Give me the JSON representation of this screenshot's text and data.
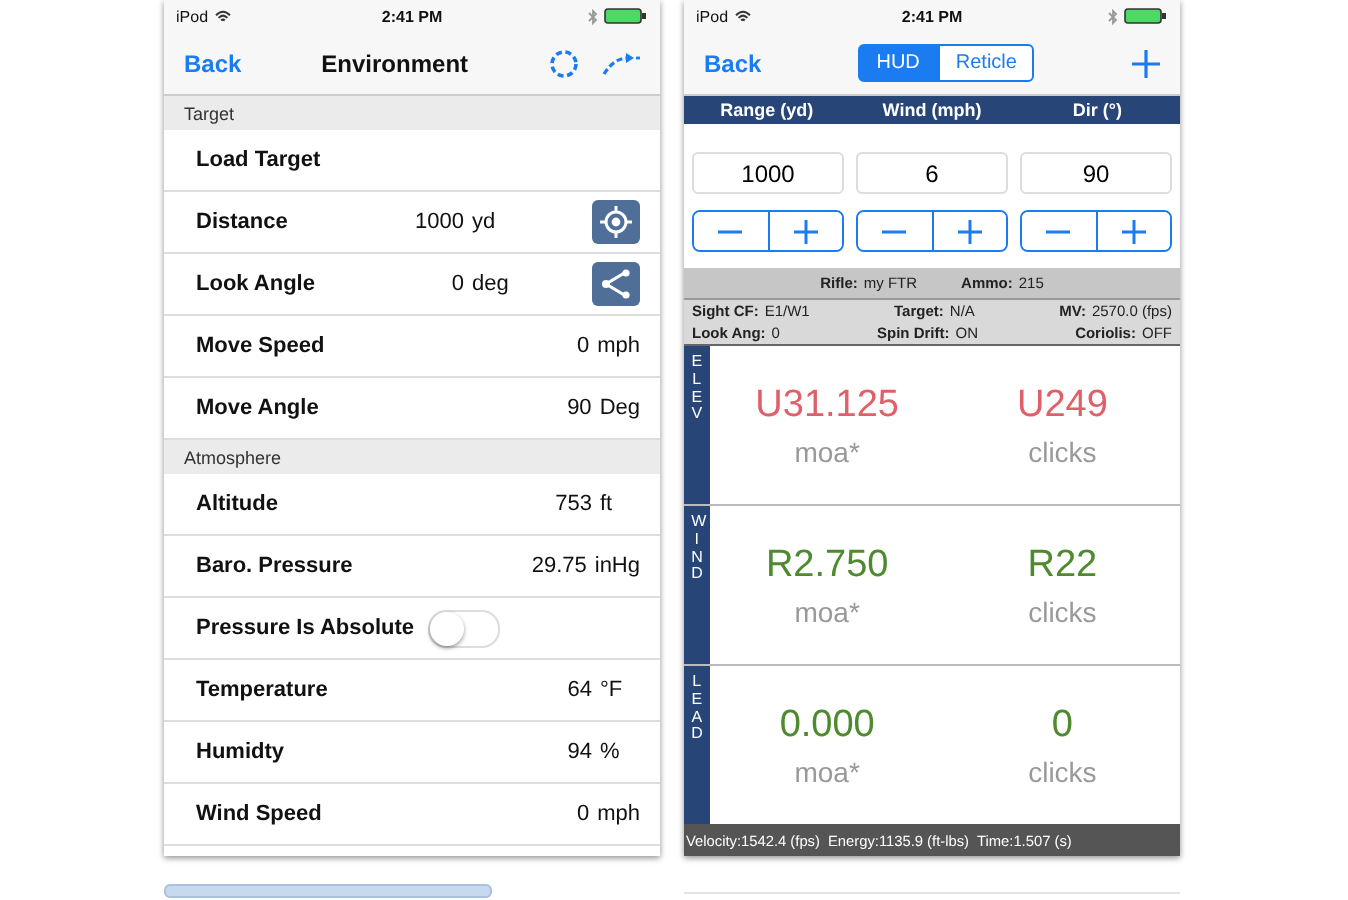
{
  "left_screen": {
    "status_bar": {
      "carrier": "iPod",
      "time": "2:41 PM"
    },
    "nav": {
      "back": "Back",
      "title": "Environment"
    },
    "sections": [
      {
        "header": "Target",
        "rows": [
          {
            "kind": "link",
            "label": "Load Target"
          },
          {
            "kind": "crosshair",
            "label": "Distance",
            "value": "1000",
            "unit": "yd"
          },
          {
            "kind": "angle",
            "label": "Look Angle",
            "value": "0",
            "unit": "deg"
          },
          {
            "kind": "value",
            "label": "Move Speed",
            "value": "0",
            "unit": "mph"
          },
          {
            "kind": "value",
            "label": "Move Angle",
            "value": "90",
            "unit": "Deg"
          }
        ]
      },
      {
        "header": "Atmosphere",
        "rows": [
          {
            "kind": "value",
            "label": "Altitude",
            "value": "753",
            "unit": "ft"
          },
          {
            "kind": "value",
            "label": "Baro. Pressure",
            "value": "29.75",
            "unit": "inHg"
          },
          {
            "kind": "toggle",
            "label": "Pressure Is Absolute",
            "on": false
          },
          {
            "kind": "value",
            "label": "Temperature",
            "value": "64",
            "unit": "°F"
          },
          {
            "kind": "value",
            "label": "Humidty",
            "value": "94",
            "unit": "%"
          },
          {
            "kind": "value",
            "label": "Wind Speed",
            "value": "0",
            "unit": "mph"
          }
        ]
      }
    ]
  },
  "right_screen": {
    "status_bar": {
      "carrier": "iPod",
      "time": "2:41 PM"
    },
    "nav": {
      "back": "Back",
      "segments": [
        {
          "label": "HUD",
          "selected": true
        },
        {
          "label": "Reticle",
          "selected": false
        }
      ]
    },
    "inputs": [
      {
        "heading": "Range (yd)",
        "value": "1000"
      },
      {
        "heading": "Wind (mph)",
        "value": "6"
      },
      {
        "heading": "Dir (°)",
        "value": "90"
      }
    ],
    "info_lines": [
      [
        {
          "label": "Rifle:",
          "value": "my FTR"
        },
        {
          "label": "Ammo:",
          "value": "215"
        }
      ],
      [
        {
          "label": "Sight CF:",
          "value": "E1/W1"
        },
        {
          "label": "Target:",
          "value": "N/A"
        },
        {
          "label": "MV:",
          "value": "2570.0 (fps)"
        }
      ],
      [
        {
          "label": "Look Ang:",
          "value": "0"
        },
        {
          "label": "Spin Drift:",
          "value": "ON"
        },
        {
          "label": "Coriolis:",
          "value": "OFF"
        }
      ]
    ],
    "results": [
      {
        "label": "ELEV",
        "moa": "U31.125",
        "moa_unit": "moa*",
        "clicks": "U249",
        "clicks_unit": "clicks",
        "color": "#e0606a"
      },
      {
        "label": "WIND",
        "moa": "R2.750",
        "moa_unit": "moa*",
        "clicks": "R22",
        "clicks_unit": "clicks",
        "color": "#4e8a2e"
      },
      {
        "label": "LEAD",
        "moa": "0.000",
        "moa_unit": "moa*",
        "clicks": "0",
        "clicks_unit": "clicks",
        "color": "#4e8a2e"
      }
    ],
    "footer": [
      "Velocity:1542.4 (fps)",
      "Energy:1135.9 (ft-lbs)",
      "Time:1.507 (s)"
    ]
  }
}
